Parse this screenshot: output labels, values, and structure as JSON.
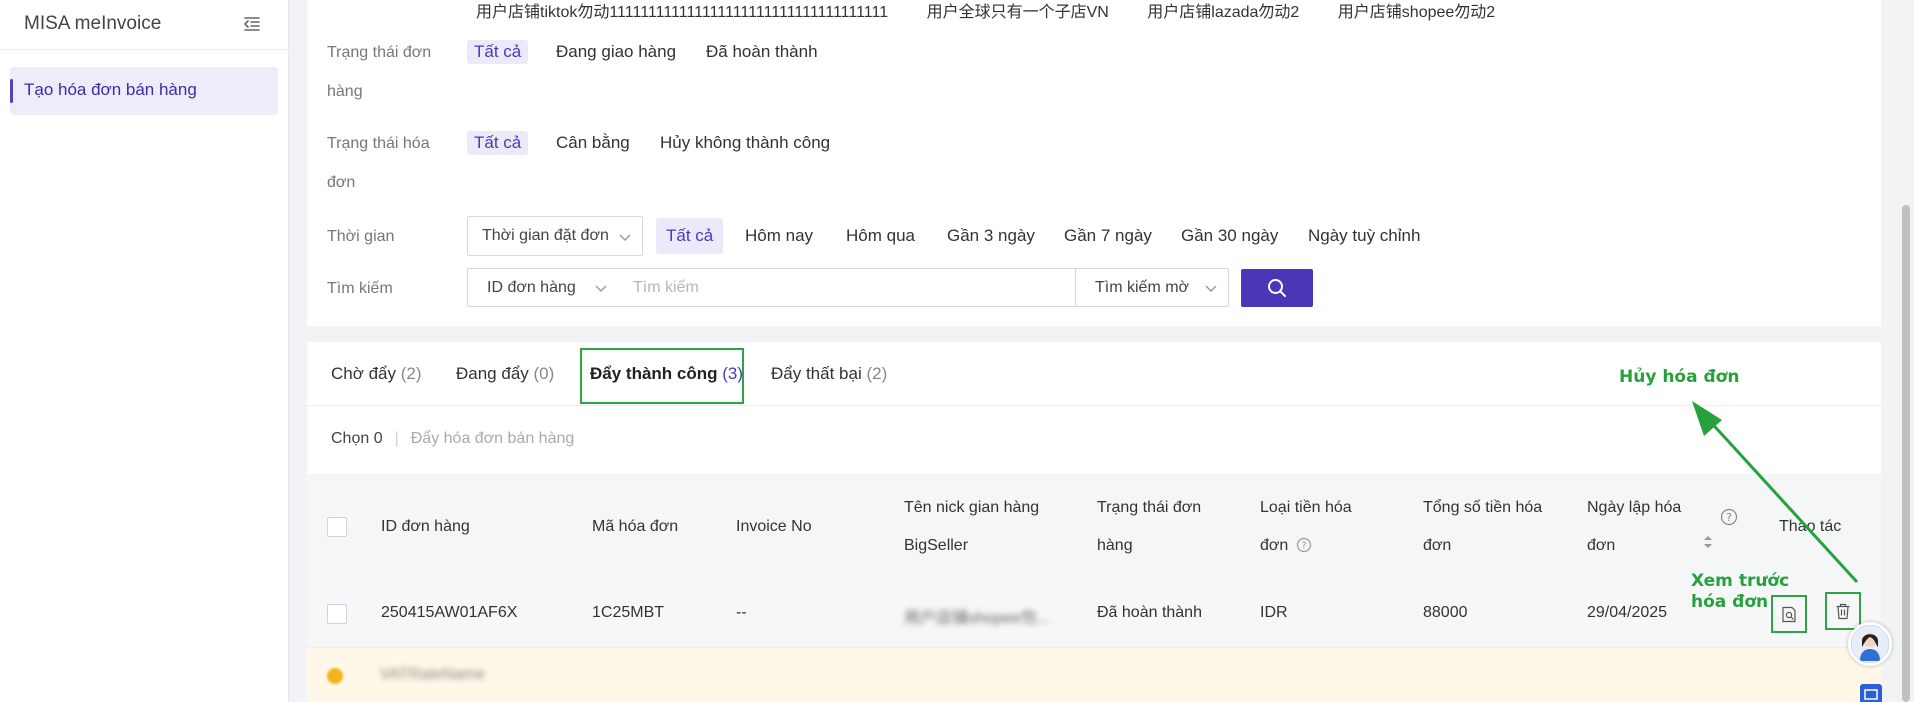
{
  "sidebar": {
    "app_title": "MISA meInvoice",
    "active_item": "Tạo hóa đơn bán hàng"
  },
  "filters": {
    "store_names": [
      "用户店铺tiktok勿动111111111111111111111111111111111111",
      "用户全球只有一个子店VN",
      "用户店铺lazada勿动2",
      "用户店铺shopee勿动2"
    ],
    "order_status": {
      "label_line1": "Trạng thái đơn",
      "label_line2": "hàng",
      "options": [
        "Tất cả",
        "Đang giao hàng",
        "Đã hoàn thành"
      ]
    },
    "invoice_status": {
      "label_line1": "Trạng thái hóa",
      "label_line2": "đơn",
      "options": [
        "Tất cả",
        "Cân bằng",
        "Hủy không thành công"
      ]
    },
    "time": {
      "label": "Thời gian",
      "select": "Thời gian đặt đơn",
      "options": [
        "Tất cả",
        "Hôm nay",
        "Hôm qua",
        "Gần 3 ngày",
        "Gần 7 ngày",
        "Gần 30 ngày",
        "Ngày tuỳ chỉnh"
      ]
    },
    "search": {
      "label": "Tìm kiếm",
      "field_select": "ID đơn hàng",
      "placeholder": "Tìm kiếm",
      "mode_select": "Tìm kiếm mờ"
    }
  },
  "tabs": [
    {
      "label": "Chờ đẩy",
      "count": "(2)"
    },
    {
      "label": "Đang đẩy",
      "count": "(0)"
    },
    {
      "label": "Đẩy thành công",
      "count": "(3)"
    },
    {
      "label": "Đẩy thất bại",
      "count": "(2)"
    }
  ],
  "selection": {
    "chosen": "Chọn 0",
    "bulk_action": "Đẩy hóa đơn bán hàng"
  },
  "table": {
    "headers": {
      "order_id": "ID đơn hàng",
      "invoice_code": "Mã hóa đơn",
      "invoice_no": "Invoice No",
      "store_nick_l1": "Tên nick gian hàng",
      "store_nick_l2": "BigSeller",
      "order_status_l1": "Trạng thái đơn",
      "order_status_l2": "hàng",
      "currency_l1": "Loại tiền hóa",
      "currency_l2": "đơn",
      "total_l1": "Tổng số tiền hóa",
      "total_l2": "đơn",
      "date_l1": "Ngày lập hóa",
      "date_l2": "đơn",
      "actions": "Thao tác"
    },
    "row": {
      "order_id": "250415AW01AF6X",
      "invoice_code": "1C25MBT",
      "invoice_no": "--",
      "store_nick": "用户店铺shopee勿...",
      "order_status": "Đã hoàn thành",
      "currency": "IDR",
      "total": "88000",
      "date": "29/04/2025"
    },
    "sub_row_label": "VATRateName"
  },
  "annotations": {
    "cancel_line": "Hủy hóa đơn",
    "preview_line1": "Xem trước",
    "preview_line2": "hóa đơn"
  },
  "colors": {
    "primary": "#4b36b8",
    "annotation_green": "#27a13c",
    "selected_bg": "#ece9fa"
  }
}
